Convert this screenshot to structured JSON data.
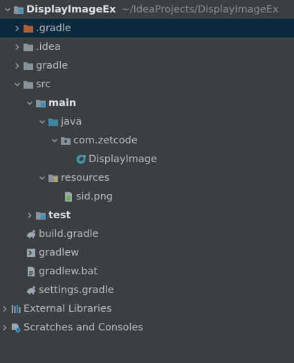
{
  "project": {
    "name": "DisplayImageEx",
    "path": "~/IdeaProjects/DisplayImageEx"
  },
  "colors": {
    "folder": "#87939a",
    "excluded_folder": "#cc7832",
    "source_folder": "#3e86a0",
    "selection": "#0d293e"
  },
  "tree": [
    {
      "label": ".gradle",
      "icon": "folder-icon-excluded",
      "state": "collapsed"
    },
    {
      "label": ".idea",
      "icon": "folder-icon",
      "state": "collapsed"
    },
    {
      "label": "gradle",
      "icon": "folder-icon",
      "state": "collapsed"
    },
    {
      "label": "src",
      "icon": "folder-icon",
      "state": "expanded"
    },
    {
      "label": "main",
      "icon": "module-folder-icon",
      "state": "expanded"
    },
    {
      "label": "java",
      "icon": "source-folder-icon",
      "state": "expanded"
    },
    {
      "label": "com.zetcode",
      "icon": "package-icon",
      "state": "expanded"
    },
    {
      "label": "DisplayImage",
      "icon": "java-class-icon",
      "state": "leaf"
    },
    {
      "label": "resources",
      "icon": "resources-folder-icon",
      "state": "expanded"
    },
    {
      "label": "sid.png",
      "icon": "image-file-icon",
      "state": "leaf"
    },
    {
      "label": "test",
      "icon": "module-folder-icon",
      "state": "collapsed"
    },
    {
      "label": "build.gradle",
      "icon": "gradle-icon",
      "state": "leaf"
    },
    {
      "label": "gradlew",
      "icon": "terminal-file-icon",
      "state": "leaf"
    },
    {
      "label": "gradlew.bat",
      "icon": "text-file-icon",
      "state": "leaf"
    },
    {
      "label": "settings.gradle",
      "icon": "gradle-icon",
      "state": "leaf"
    },
    {
      "label": "External Libraries",
      "icon": "libraries-icon",
      "state": "collapsed"
    },
    {
      "label": "Scratches and Consoles",
      "icon": "scratches-icon",
      "state": "collapsed"
    }
  ]
}
